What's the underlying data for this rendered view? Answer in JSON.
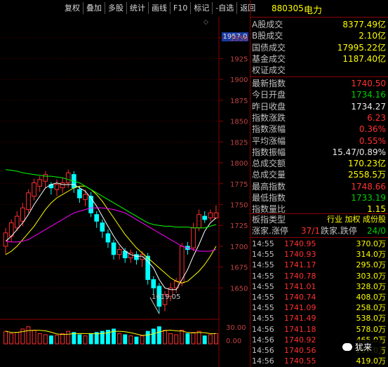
{
  "toolbar": [
    "复权",
    "叠加",
    "多股",
    "统计",
    "画线",
    "F10",
    "标记",
    "-自选",
    "返回"
  ],
  "stock": {
    "code": "880305",
    "name": "电力"
  },
  "stats": [
    {
      "label": "A股成交",
      "value": "8377.49亿",
      "color": "yel"
    },
    {
      "label": "B股成交",
      "value": "2.10亿",
      "color": "yel"
    },
    {
      "label": "国债成交",
      "value": "17995.22亿",
      "color": "yel"
    },
    {
      "label": "基金成交",
      "value": "1187.40亿",
      "color": "yel"
    },
    {
      "label": "权证成交",
      "value": "",
      "color": "yel"
    }
  ],
  "quotes": [
    {
      "label": "最新指数",
      "value": "1740.50",
      "color": "red"
    },
    {
      "label": "今日开盘",
      "value": "1734.16",
      "color": "grn"
    },
    {
      "label": "昨日收盘",
      "value": "1734.27",
      "color": "wht"
    },
    {
      "label": "指数涨跌",
      "value": "6.23",
      "color": "red"
    },
    {
      "label": "指数涨幅",
      "value": "0.36%",
      "color": "red"
    },
    {
      "label": "平均涨幅",
      "value": "0.55%",
      "color": "red"
    },
    {
      "label": "指数振幅",
      "value": "15.47/0.89%",
      "color": "wht"
    },
    {
      "label": "总成交额",
      "value": "170.23亿",
      "color": "yel"
    },
    {
      "label": "总成交量",
      "value": "2558.5万",
      "color": "yel"
    },
    {
      "label": "最高指数",
      "value": "1748.66",
      "color": "red"
    },
    {
      "label": "最低指数",
      "value": "1733.19",
      "color": "grn"
    },
    {
      "label": "指数量比",
      "value": "1.15",
      "color": "yel"
    }
  ],
  "board": {
    "type_label": "板指类型",
    "type_value": "行业 加权 成份股",
    "rise_label": "涨家.涨停",
    "rise_value": "37/1",
    "fall_label": "跌家.跌停",
    "fall_value": "24/0"
  },
  "ticks": [
    {
      "time": "14:55",
      "price": "1740.95",
      "vol": "370.0万"
    },
    {
      "time": "14:55",
      "price": "1740.93",
      "vol": "314.0万"
    },
    {
      "time": "14:55",
      "price": "1741.17",
      "vol": "295.0万"
    },
    {
      "time": "14:55",
      "price": "1740.78",
      "vol": "303.0万"
    },
    {
      "time": "14:55",
      "price": "1741.01",
      "vol": "328.0万"
    },
    {
      "time": "14:55",
      "price": "1740.74",
      "vol": "408.0万"
    },
    {
      "time": "14:55",
      "price": "1741.09",
      "vol": "258.0万"
    },
    {
      "time": "14:55",
      "price": "1741.49",
      "vol": "538.0万"
    },
    {
      "time": "14:56",
      "price": "1741.18",
      "vol": "578.0万"
    },
    {
      "time": "14:56",
      "price": "1740.92",
      "vol": "465.0万"
    },
    {
      "time": "14:56",
      "price": "1740.56",
      "vol": "287.0万"
    },
    {
      "time": "14:56",
      "price": "1740.55",
      "vol": "419.0万"
    }
  ],
  "axis": {
    "price_ticks": [
      "1950",
      "1925",
      "1900",
      "1875",
      "1850",
      "1825",
      "1800",
      "1775",
      "1750",
      "1725",
      "1700",
      "1675",
      "1650"
    ],
    "top_label": "1957.0",
    "low_label": "1619.05",
    "vol_ticks": [
      "30.00",
      "0.00"
    ]
  },
  "watermark": "犹来",
  "chart_data": {
    "type": "candlestick",
    "ylim": [
      1625,
      1965
    ],
    "candles": [
      [
        1700,
        1716,
        1690,
        1722
      ],
      [
        1712,
        1728,
        1705,
        1732
      ],
      [
        1722,
        1736,
        1718,
        1742
      ],
      [
        1730,
        1746,
        1724,
        1752
      ],
      [
        1744,
        1764,
        1740,
        1768
      ],
      [
        1760,
        1776,
        1755,
        1781
      ],
      [
        1772,
        1780,
        1765,
        1784
      ],
      [
        1778,
        1786,
        1770,
        1790
      ],
      [
        1774,
        1770,
        1762,
        1777
      ],
      [
        1768,
        1774,
        1760,
        1780
      ],
      [
        1770,
        1776,
        1764,
        1782
      ],
      [
        1776,
        1788,
        1770,
        1792
      ],
      [
        1786,
        1770,
        1764,
        1790
      ],
      [
        1768,
        1758,
        1752,
        1772
      ],
      [
        1756,
        1762,
        1748,
        1768
      ],
      [
        1760,
        1740,
        1735,
        1765
      ],
      [
        1738,
        1730,
        1722,
        1742
      ],
      [
        1728,
        1718,
        1710,
        1732
      ],
      [
        1715,
        1705,
        1698,
        1720
      ],
      [
        1704,
        1690,
        1684,
        1708
      ],
      [
        1690,
        1696,
        1684,
        1700
      ],
      [
        1694,
        1686,
        1680,
        1698
      ],
      [
        1686,
        1692,
        1680,
        1696
      ],
      [
        1690,
        1684,
        1678,
        1694
      ],
      [
        1684,
        1690,
        1675,
        1694
      ],
      [
        1688,
        1660,
        1654,
        1692
      ],
      [
        1660,
        1650,
        1642,
        1664
      ],
      [
        1652,
        1628,
        1619,
        1656
      ],
      [
        1630,
        1642,
        1622,
        1646
      ],
      [
        1640,
        1650,
        1634,
        1656
      ],
      [
        1650,
        1658,
        1644,
        1662
      ],
      [
        1656,
        1700,
        1652,
        1704
      ],
      [
        1700,
        1696,
        1690,
        1705
      ],
      [
        1698,
        1722,
        1694,
        1728
      ],
      [
        1722,
        1738,
        1718,
        1744
      ],
      [
        1736,
        1732,
        1728,
        1742
      ],
      [
        1734,
        1740,
        1730,
        1744
      ],
      [
        1734,
        1740,
        1733,
        1749
      ]
    ],
    "ma": [
      {
        "name": "MA5",
        "color": "#ffffff",
        "values": [
          1706,
          1712,
          1720,
          1728,
          1738,
          1750,
          1760,
          1770,
          1774,
          1776,
          1774,
          1774,
          1774,
          1770,
          1766,
          1758,
          1748,
          1736,
          1724,
          1712,
          1702,
          1694,
          1690,
          1688,
          1688,
          1682,
          1674,
          1660,
          1650,
          1648,
          1648,
          1660,
          1672,
          1688,
          1702,
          1718,
          1728,
          1734
        ]
      },
      {
        "name": "MA10",
        "color": "#ffff00",
        "values": [
          1690,
          1694,
          1700,
          1708,
          1716,
          1724,
          1734,
          1744,
          1752,
          1758,
          1762,
          1766,
          1770,
          1772,
          1772,
          1768,
          1762,
          1754,
          1744,
          1734,
          1724,
          1714,
          1706,
          1698,
          1692,
          1686,
          1680,
          1674,
          1668,
          1662,
          1658,
          1656,
          1658,
          1664,
          1670,
          1678,
          1688,
          1700
        ]
      },
      {
        "name": "MA20",
        "color": "#00ff00",
        "values": [
          1792,
          1791,
          1790,
          1788,
          1787,
          1786,
          1785,
          1784,
          1784,
          1783,
          1782,
          1780,
          1778,
          1776,
          1772,
          1768,
          1764,
          1760,
          1756,
          1752,
          1748,
          1744,
          1740,
          1736,
          1732,
          1728,
          1726,
          1725,
          1724,
          1724,
          1723,
          1723,
          1723,
          1722,
          1722,
          1722,
          1724,
          1726
        ]
      },
      {
        "name": "MA60",
        "color": "#ff00ff",
        "values": [
          1706,
          1705,
          1705,
          1706,
          1708,
          1712,
          1716,
          1720,
          1724,
          1728,
          1732,
          1736,
          1740,
          1742,
          1744,
          1746,
          1746,
          1746,
          1745,
          1744,
          1742,
          1740,
          1736,
          1732,
          1728,
          1724,
          1720,
          1716,
          1712,
          1708,
          1704,
          1700,
          1698,
          1696,
          1694,
          1694,
          1694,
          1696
        ]
      }
    ],
    "volume": [
      22,
      18,
      20,
      26,
      30,
      24,
      18,
      16,
      14,
      15,
      18,
      22,
      20,
      16,
      14,
      18,
      20,
      22,
      24,
      26,
      18,
      16,
      14,
      12,
      14,
      22,
      26,
      30,
      24,
      18,
      16,
      24,
      18,
      20,
      22,
      14,
      16,
      18
    ]
  }
}
